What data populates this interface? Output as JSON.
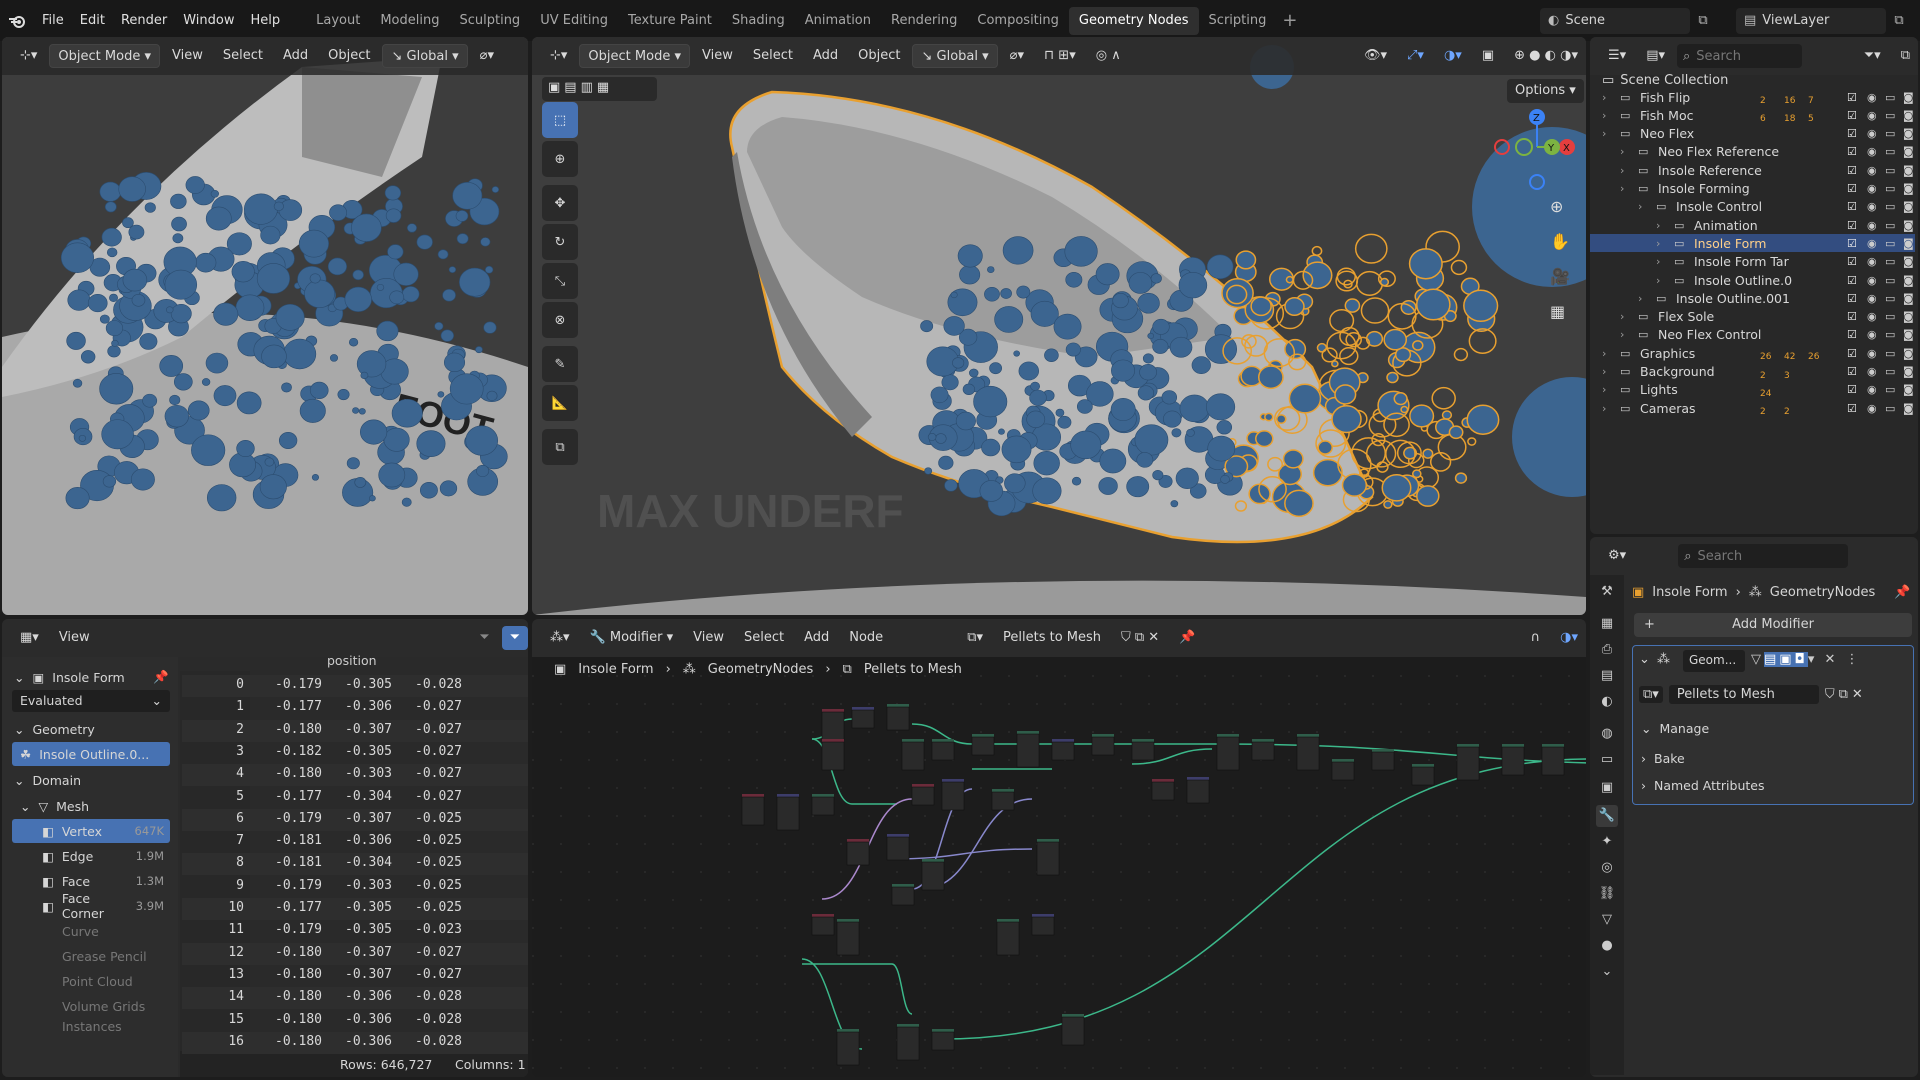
{
  "menu": [
    "File",
    "Edit",
    "Render",
    "Window",
    "Help"
  ],
  "workspaces": [
    "Layout",
    "Modeling",
    "Sculpting",
    "UV Editing",
    "Texture Paint",
    "Shading",
    "Animation",
    "Rendering",
    "Compositing",
    "Geometry Nodes",
    "Scripting"
  ],
  "active_workspace": "Geometry Nodes",
  "scene": "Scene",
  "viewlayer": "ViewLayer",
  "vp1": {
    "mode": "Object Mode",
    "menus": [
      "View",
      "Select",
      "Add",
      "Object"
    ],
    "orientation": "Global",
    "overlay_text": "FOOT"
  },
  "vp2": {
    "mode": "Object Mode",
    "menus": [
      "View",
      "Select",
      "Add",
      "Object"
    ],
    "orientation": "Global",
    "options": "Options",
    "overlay_text": "MAX UNDERF"
  },
  "outliner": {
    "search": "Search",
    "root": "Scene Collection",
    "items": [
      {
        "name": "Fish Flip",
        "indent": 0
      },
      {
        "name": "Fish Moc",
        "indent": 0
      },
      {
        "name": "Neo Flex",
        "indent": 0
      },
      {
        "name": "Neo Flex Reference",
        "indent": 1
      },
      {
        "name": "Insole Reference",
        "indent": 1
      },
      {
        "name": "Insole Forming",
        "indent": 1
      },
      {
        "name": "Insole Control",
        "indent": 2
      },
      {
        "name": "Animation",
        "indent": 3
      },
      {
        "name": "Insole Form",
        "indent": 3
      },
      {
        "name": "Insole Form Tar",
        "indent": 3
      },
      {
        "name": "Insole Outline.0",
        "indent": 3
      },
      {
        "name": "Insole Outline.001",
        "indent": 2
      },
      {
        "name": "Flex Sole",
        "indent": 1
      },
      {
        "name": "Neo Flex Control",
        "indent": 1
      },
      {
        "name": "Graphics",
        "indent": 0
      },
      {
        "name": "Background",
        "indent": 0
      },
      {
        "name": "Lights",
        "indent": 0
      },
      {
        "name": "Cameras",
        "indent": 0
      }
    ],
    "selected": "Insole Form",
    "badges": {
      "Fish Flip": [
        "2",
        "16",
        "7"
      ],
      "Fish Moc": [
        "6",
        "18",
        "5"
      ],
      "Graphics": [
        "26",
        "42",
        "26"
      ],
      "Background": [
        "2",
        "3"
      ],
      "Lights": [
        "24"
      ],
      "Cameras": [
        "2",
        "2"
      ]
    }
  },
  "props": {
    "search": "Search",
    "breadcrumb": [
      "Insole Form",
      "GeometryNodes"
    ],
    "add_modifier": "Add Modifier",
    "modifier_name": "Geom...",
    "node_group": "Pellets to Mesh",
    "sections": [
      "Manage",
      "Bake",
      "Named Attributes"
    ]
  },
  "spreadsheet": {
    "view": "View",
    "object": "Insole Form",
    "eval": "Evaluated",
    "geometry": "Geometry",
    "geom_item": "Insole Outline.0...",
    "domain": "Domain",
    "mesh": "Mesh",
    "domains": [
      {
        "name": "Vertex",
        "count": "647K"
      },
      {
        "name": "Edge",
        "count": "1.9M"
      },
      {
        "name": "Face",
        "count": "1.3M"
      },
      {
        "name": "Face Corner",
        "count": "3.9M"
      }
    ],
    "other": [
      "Curve",
      "Grease Pencil",
      "Point Cloud",
      "Volume Grids",
      "Instances"
    ],
    "column": "position",
    "rows": [
      [
        "0",
        "-0.179",
        "-0.305",
        "-0.028"
      ],
      [
        "1",
        "-0.177",
        "-0.306",
        "-0.027"
      ],
      [
        "2",
        "-0.180",
        "-0.307",
        "-0.027"
      ],
      [
        "3",
        "-0.182",
        "-0.305",
        "-0.027"
      ],
      [
        "4",
        "-0.180",
        "-0.303",
        "-0.027"
      ],
      [
        "5",
        "-0.177",
        "-0.304",
        "-0.027"
      ],
      [
        "6",
        "-0.179",
        "-0.307",
        "-0.025"
      ],
      [
        "7",
        "-0.181",
        "-0.306",
        "-0.025"
      ],
      [
        "8",
        "-0.181",
        "-0.304",
        "-0.025"
      ],
      [
        "9",
        "-0.179",
        "-0.303",
        "-0.025"
      ],
      [
        "10",
        "-0.177",
        "-0.305",
        "-0.025"
      ],
      [
        "11",
        "-0.179",
        "-0.305",
        "-0.023"
      ],
      [
        "12",
        "-0.180",
        "-0.307",
        "-0.027"
      ],
      [
        "13",
        "-0.180",
        "-0.307",
        "-0.027"
      ],
      [
        "14",
        "-0.180",
        "-0.306",
        "-0.028"
      ],
      [
        "15",
        "-0.180",
        "-0.306",
        "-0.028"
      ],
      [
        "16",
        "-0.180",
        "-0.306",
        "-0.028"
      ]
    ],
    "rows_status": "Rows: 646,727",
    "cols_status": "Columns: 1"
  },
  "nodeeditor": {
    "modifier": "Modifier",
    "menus": [
      "View",
      "Select",
      "Add",
      "Node"
    ],
    "group": "Pellets to Mesh",
    "breadcrumb": [
      "Insole Form",
      "GeometryNodes",
      "Pellets to Mesh"
    ]
  },
  "colors": {
    "accent": "#4772b3",
    "selected_outline": "#e8a030",
    "sphere": "#3c6590",
    "bg": "#1d1d1d"
  }
}
